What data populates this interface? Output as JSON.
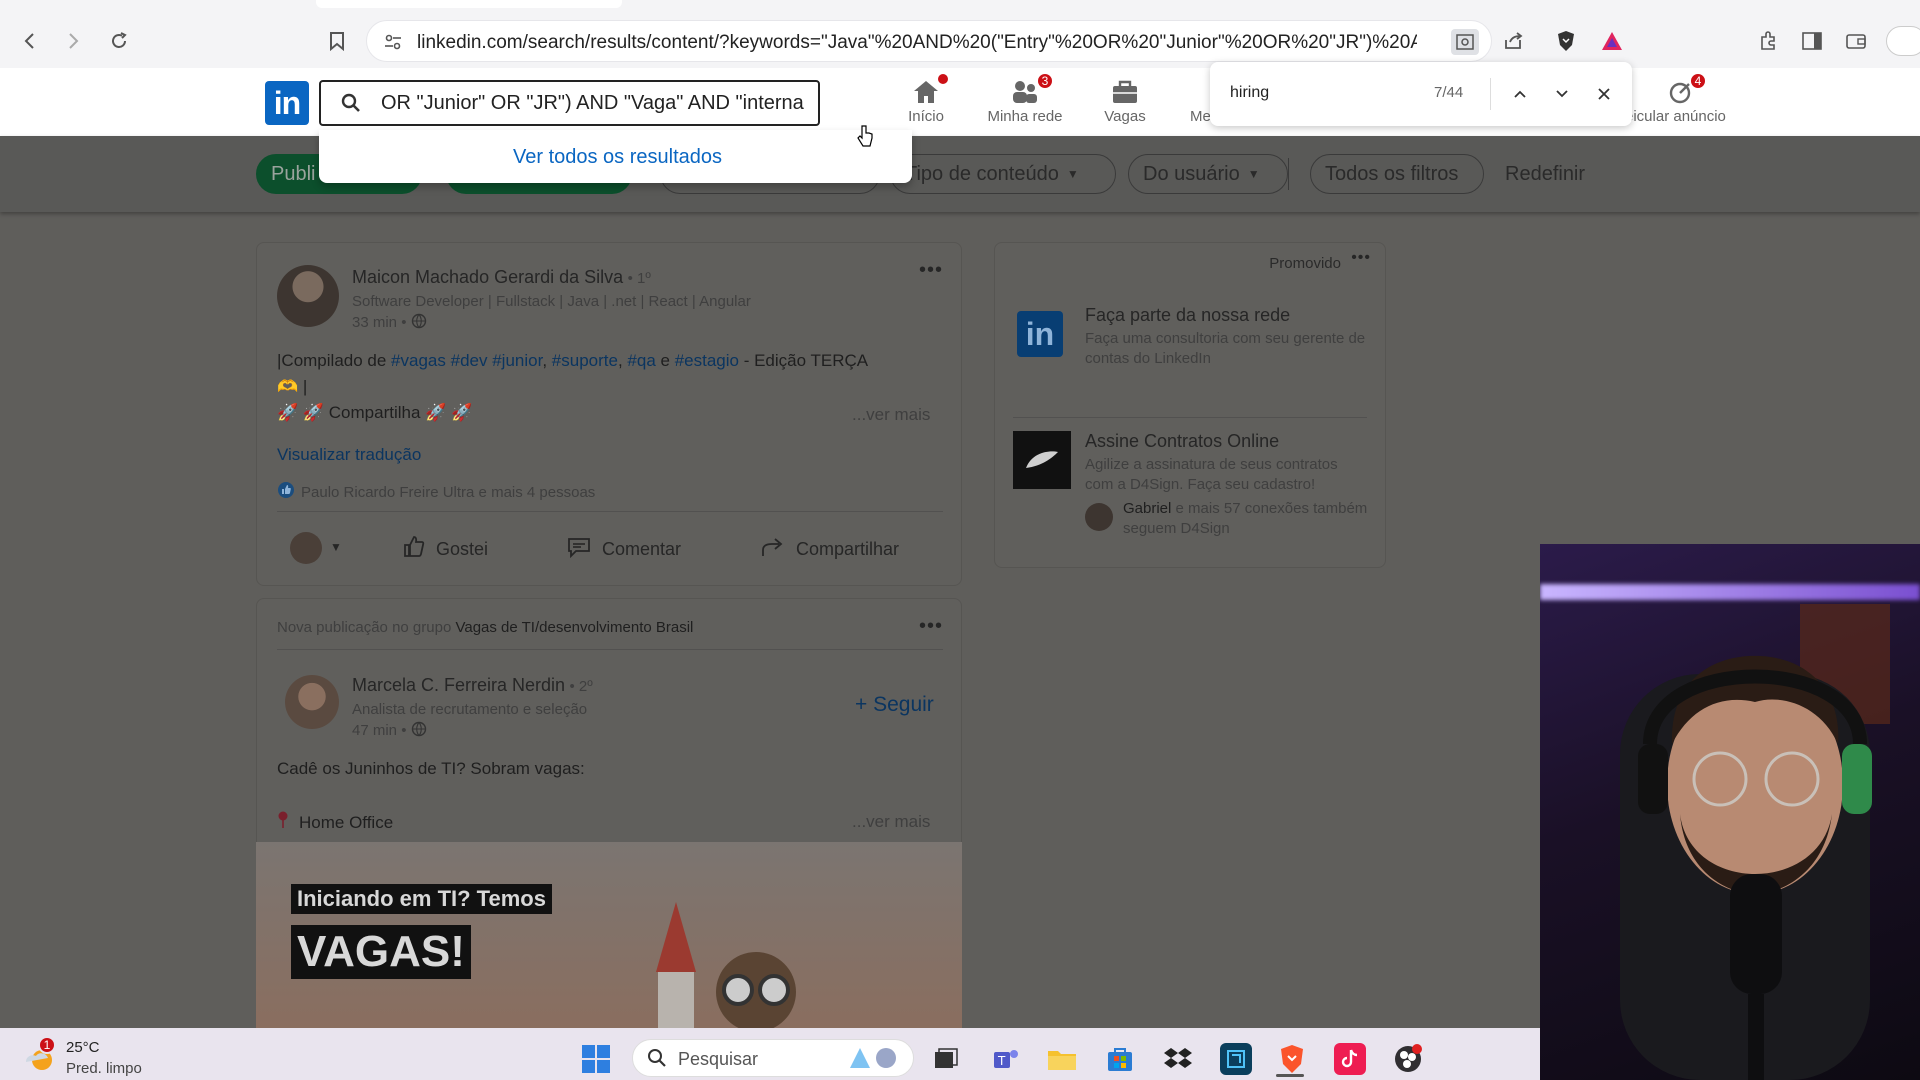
{
  "browser": {
    "url": "linkedin.com/search/results/content/?keywords=\"Java\"%20AND%20(\"Entry\"%20OR%20\"Junior\"%20OR%20\"JR\")%20AND%20\"..."
  },
  "find_bar": {
    "query": "hiring",
    "count": "7/44"
  },
  "header": {
    "search_value": "OR \"Junior\" OR \"JR\") AND \"Vaga\" AND \"interna",
    "nav": [
      {
        "label": "Início",
        "badge": ""
      },
      {
        "label": "Minha rede",
        "badge": "3"
      },
      {
        "label": "Vagas",
        "badge": ""
      },
      {
        "label": "Me",
        "badge": ""
      },
      {
        "label": "eicular anúncio",
        "badge": "4"
      }
    ]
  },
  "suggestion": {
    "label": "Ver todos os resultados"
  },
  "filters": {
    "chips": [
      "Publi",
      "Tipo de conteúdo",
      "Do usuário",
      "Todos os filtros"
    ],
    "reset": "Redefinir"
  },
  "posts": [
    {
      "author": "Maicon Machado Gerardi da Silva",
      "degree": "• 1º",
      "headline": "Software Developer | Fullstack | Java | .net | React | Angular",
      "time": "33 min •",
      "text_prefix": "|Compilado de ",
      "tags": [
        "#vagas",
        "#dev",
        "#junior",
        "#suporte",
        "#qa",
        "#estagio"
      ],
      "text_suffix": " - Edição TERÇA",
      "line2": "🫶 |",
      "line3": "🚀 🚀 Compartilha 🚀 🚀",
      "see_more": "...ver mais",
      "translate": "Visualizar tradução",
      "reactions": "Paulo Ricardo Freire Ultra e mais 4 pessoas",
      "actions": {
        "like": "Gostei",
        "comment": "Comentar",
        "share": "Compartilhar"
      }
    },
    {
      "group_prefix": "Nova publicação no grupo ",
      "group_name": "Vagas de TI/desenvolvimento Brasil",
      "author": "Marcela C. Ferreira Nerdin",
      "degree": "• 2º",
      "headline": "Analista de recrutamento e seleção",
      "time": "47 min •",
      "follow": "+ Seguir",
      "text": "Cadê os Juninhos de TI? Sobram vagas:",
      "location": "Home Office",
      "see_more": "...ver mais",
      "image_text_1": "Iniciando em TI? Temos",
      "image_text_2": "VAGAS!"
    }
  ],
  "promo": {
    "label": "Promovido",
    "ads": [
      {
        "title": "Faça parte da nossa rede",
        "desc": "Faça uma consultoria com seu gerente de contas do LinkedIn"
      },
      {
        "title": "Assine Contratos Online",
        "desc": "Agilize a assinatura de seus contratos com a D4Sign. Faça seu cadastro!",
        "social_name": "Gabriel",
        "social_rest": " e mais 57 conexões também seguem D4Sign"
      }
    ]
  },
  "taskbar": {
    "weather_temp": "25°C",
    "weather_desc": "Pred. limpo",
    "weather_badge": "1",
    "search_placeholder": "Pesquisar"
  },
  "colors": {
    "linkedin_blue": "#0a66c2",
    "badge_red": "#cc1016",
    "chip_green": "#0c4f2c"
  }
}
